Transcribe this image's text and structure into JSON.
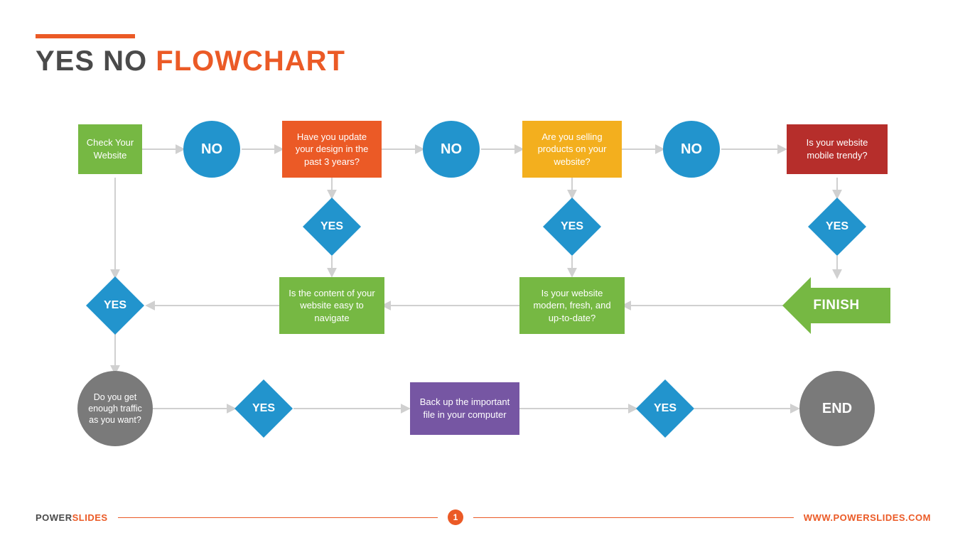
{
  "title": {
    "part1": "YES NO ",
    "part2": "FLOWCHART"
  },
  "labels": {
    "no": "NO",
    "yes": "YES",
    "finish": "FINISH",
    "end": "END"
  },
  "nodes": {
    "check": "Check Your Website",
    "update": "Have you update your design in the past 3 years?",
    "selling": "Are you selling products on your website?",
    "mobile": "Is your website mobile trendy?",
    "navigate": "Is the content of your website easy to navigate",
    "modern": "Is your website modern, fresh, and up-to-date?",
    "traffic": "Do you get enough traffic as you want?",
    "backup": "Back up the important file in your computer"
  },
  "colors": {
    "green": "#76b843",
    "orange": "#eb5a26",
    "amber": "#f3af1e",
    "red": "#b62e2b",
    "blue": "#2294cd",
    "purple": "#7656a3",
    "gray": "#7a7a7a",
    "arrow": "#d0d0d0"
  },
  "footer": {
    "brand1": "POWER",
    "brand2": "SLIDES",
    "url": "WWW.POWERSLIDES.COM",
    "page": "1"
  },
  "chart_data": {
    "type": "flowchart",
    "title": "YES NO FLOWCHART",
    "nodes": [
      {
        "id": "check",
        "shape": "rect",
        "color": "green",
        "row": 1,
        "text": "Check Your Website"
      },
      {
        "id": "no1",
        "shape": "circle",
        "color": "blue",
        "row": 1,
        "text": "NO"
      },
      {
        "id": "update",
        "shape": "rect",
        "color": "orange",
        "row": 1,
        "text": "Have you update your design in the past 3 years?"
      },
      {
        "id": "no2",
        "shape": "circle",
        "color": "blue",
        "row": 1,
        "text": "NO"
      },
      {
        "id": "selling",
        "shape": "rect",
        "color": "amber",
        "row": 1,
        "text": "Are you selling products on your website?"
      },
      {
        "id": "no3",
        "shape": "circle",
        "color": "blue",
        "row": 1,
        "text": "NO"
      },
      {
        "id": "mobile",
        "shape": "rect",
        "color": "red",
        "row": 1,
        "text": "Is your website mobile trendy?"
      },
      {
        "id": "yes_u",
        "shape": "diamond",
        "color": "blue",
        "row": 1.5,
        "text": "YES"
      },
      {
        "id": "yes_s",
        "shape": "diamond",
        "color": "blue",
        "row": 1.5,
        "text": "YES"
      },
      {
        "id": "yes_m",
        "shape": "diamond",
        "color": "blue",
        "row": 1.5,
        "text": "YES"
      },
      {
        "id": "yes_l",
        "shape": "diamond",
        "color": "blue",
        "row": 2,
        "text": "YES"
      },
      {
        "id": "navigate",
        "shape": "rect",
        "color": "green",
        "row": 2,
        "text": "Is the content of your website easy to navigate"
      },
      {
        "id": "modern",
        "shape": "rect",
        "color": "green",
        "row": 2,
        "text": "Is your website modern, fresh, and up-to-date?"
      },
      {
        "id": "finish",
        "shape": "arrow",
        "color": "green",
        "row": 2,
        "text": "FINISH"
      },
      {
        "id": "traffic",
        "shape": "circle",
        "color": "gray",
        "row": 3,
        "text": "Do you get enough traffic as you want?"
      },
      {
        "id": "yes_t",
        "shape": "diamond",
        "color": "blue",
        "row": 3,
        "text": "YES"
      },
      {
        "id": "backup",
        "shape": "rect",
        "color": "purple",
        "row": 3,
        "text": "Back up the important file in your computer"
      },
      {
        "id": "yes_b",
        "shape": "diamond",
        "color": "blue",
        "row": 3,
        "text": "YES"
      },
      {
        "id": "end",
        "shape": "circle",
        "color": "gray",
        "row": 3,
        "text": "END"
      }
    ],
    "edges": [
      [
        "check",
        "no1"
      ],
      [
        "no1",
        "update"
      ],
      [
        "update",
        "no2"
      ],
      [
        "no2",
        "selling"
      ],
      [
        "selling",
        "no3"
      ],
      [
        "no3",
        "mobile"
      ],
      [
        "update",
        "yes_u"
      ],
      [
        "yes_u",
        "navigate"
      ],
      [
        "selling",
        "yes_s"
      ],
      [
        "yes_s",
        "modern"
      ],
      [
        "mobile",
        "yes_m"
      ],
      [
        "yes_m",
        "finish"
      ],
      [
        "finish",
        "modern"
      ],
      [
        "modern",
        "navigate"
      ],
      [
        "navigate",
        "yes_l"
      ],
      [
        "check",
        "yes_l"
      ],
      [
        "yes_l",
        "traffic"
      ],
      [
        "traffic",
        "yes_t"
      ],
      [
        "yes_t",
        "backup"
      ],
      [
        "backup",
        "yes_b"
      ],
      [
        "yes_b",
        "end"
      ]
    ]
  }
}
